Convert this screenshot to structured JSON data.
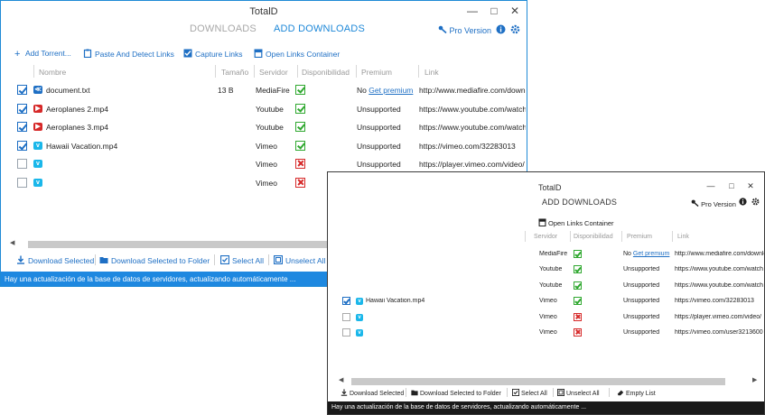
{
  "app": {
    "title": "TotalD",
    "tabs": [
      {
        "label": "DOWNLOADS",
        "active": false
      },
      {
        "label": "ADD DOWNLOADS",
        "active": true
      }
    ],
    "pro_label": "Pro Version",
    "window_controls": {
      "minimize": "—",
      "maximize": "□",
      "close": "✕"
    }
  },
  "toolbar": {
    "add_torrent": "Add Torrent...",
    "paste_detect": "Paste And Detect Links",
    "capture_links": "Capture Links",
    "open_container": "Open Links Container"
  },
  "columns": {
    "name": "Nombre",
    "size": "Tamaño",
    "server": "Servidor",
    "availability": "Disponibilidad",
    "premium": "Premium",
    "link": "Link"
  },
  "rows": [
    {
      "checked": true,
      "service": "mediafire",
      "name": "document.txt",
      "size": "13 B",
      "server": "MediaFire",
      "available": true,
      "premium_prefix": "No",
      "premium_link": "Get premium",
      "premium": "",
      "link": "http://www.mediafire.com/download"
    },
    {
      "checked": true,
      "service": "youtube",
      "name": "Aeroplanes 2.mp4",
      "size": "",
      "server": "Youtube",
      "available": true,
      "premium_prefix": "",
      "premium_link": "",
      "premium": "Unsupported",
      "link": "https://www.youtube.com/watch"
    },
    {
      "checked": true,
      "service": "youtube",
      "name": "Aeroplanes 3.mp4",
      "size": "",
      "server": "Youtube",
      "available": true,
      "premium_prefix": "",
      "premium_link": "",
      "premium": "Unsupported",
      "link": "https://www.youtube.com/watch"
    },
    {
      "checked": true,
      "service": "vimeo",
      "name": "Hawaii Vacation.mp4",
      "size": "",
      "server": "Vimeo",
      "available": true,
      "premium_prefix": "",
      "premium_link": "",
      "premium": "Unsupported",
      "link": "https://vimeo.com/32283013"
    },
    {
      "checked": false,
      "service": "vimeo",
      "name": "",
      "size": "",
      "server": "Vimeo",
      "available": false,
      "premium_prefix": "",
      "premium_link": "",
      "premium": "Unsupported",
      "link": "https://player.vimeo.com/video/"
    },
    {
      "checked": false,
      "service": "vimeo",
      "name": "",
      "size": "",
      "server": "Vimeo",
      "available": false,
      "premium_prefix": "",
      "premium_link": "",
      "premium": "Unsupported",
      "link": "https://vimeo.com/user3213600"
    }
  ],
  "bottom": {
    "download_selected": "Download Selected",
    "download_to_folder": "Download Selected to Folder",
    "select_all": "Select All",
    "unselect_all": "Unselect All",
    "empty_list": "Empty List"
  },
  "status": "Hay una actualización de la base de datos de servidores, actualizando automáticamente ...",
  "small_window": {
    "title": "TotalD",
    "tab": "ADD DOWNLOADS",
    "pro_label": "Pro Version",
    "open_container": "Open Links Container",
    "columns": {
      "server_partial": "Servidor",
      "availability": "Disponibilidad",
      "premium": "Premium",
      "link": "Link"
    },
    "rows": [
      {
        "checked": null,
        "name": "",
        "server": "MediaFire",
        "available": true,
        "premium_prefix": "No",
        "premium_link": "Get premium",
        "premium": "",
        "link": "http://www.mediafire.com/download"
      },
      {
        "checked": null,
        "name": "",
        "server": "Youtube",
        "available": true,
        "premium_prefix": "",
        "premium_link": "",
        "premium": "Unsupported",
        "link": "https://www.youtube.com/watch"
      },
      {
        "checked": null,
        "name": "",
        "server": "Youtube",
        "available": true,
        "premium_prefix": "",
        "premium_link": "",
        "premium": "Unsupported",
        "link": "https://www.youtube.com/watch"
      },
      {
        "checked": true,
        "name": "Hawaii Vacation.mp4",
        "server": "Vimeo",
        "available": true,
        "premium_prefix": "",
        "premium_link": "",
        "premium": "Unsupported",
        "link": "https://vimeo.com/32283013"
      },
      {
        "checked": false,
        "name": "",
        "server": "Vimeo",
        "available": false,
        "premium_prefix": "",
        "premium_link": "",
        "premium": "Unsupported",
        "link": "https://player.vimeo.com/video/"
      },
      {
        "checked": false,
        "name": "",
        "server": "Vimeo",
        "available": false,
        "premium_prefix": "",
        "premium_link": "",
        "premium": "Unsupported",
        "link": "https://vimeo.com/user3213600"
      }
    ]
  },
  "colors": {
    "accent": "#1e6fc4",
    "tab_active": "#1e88d8",
    "status_bar": "#1e88e0",
    "status_bar_dark": "#1a1a1a",
    "ok_green": "#2fa82f",
    "error_red": "#d62828"
  },
  "icons": {
    "key": "key-icon",
    "info": "info-icon",
    "gear": "gear-icon"
  }
}
